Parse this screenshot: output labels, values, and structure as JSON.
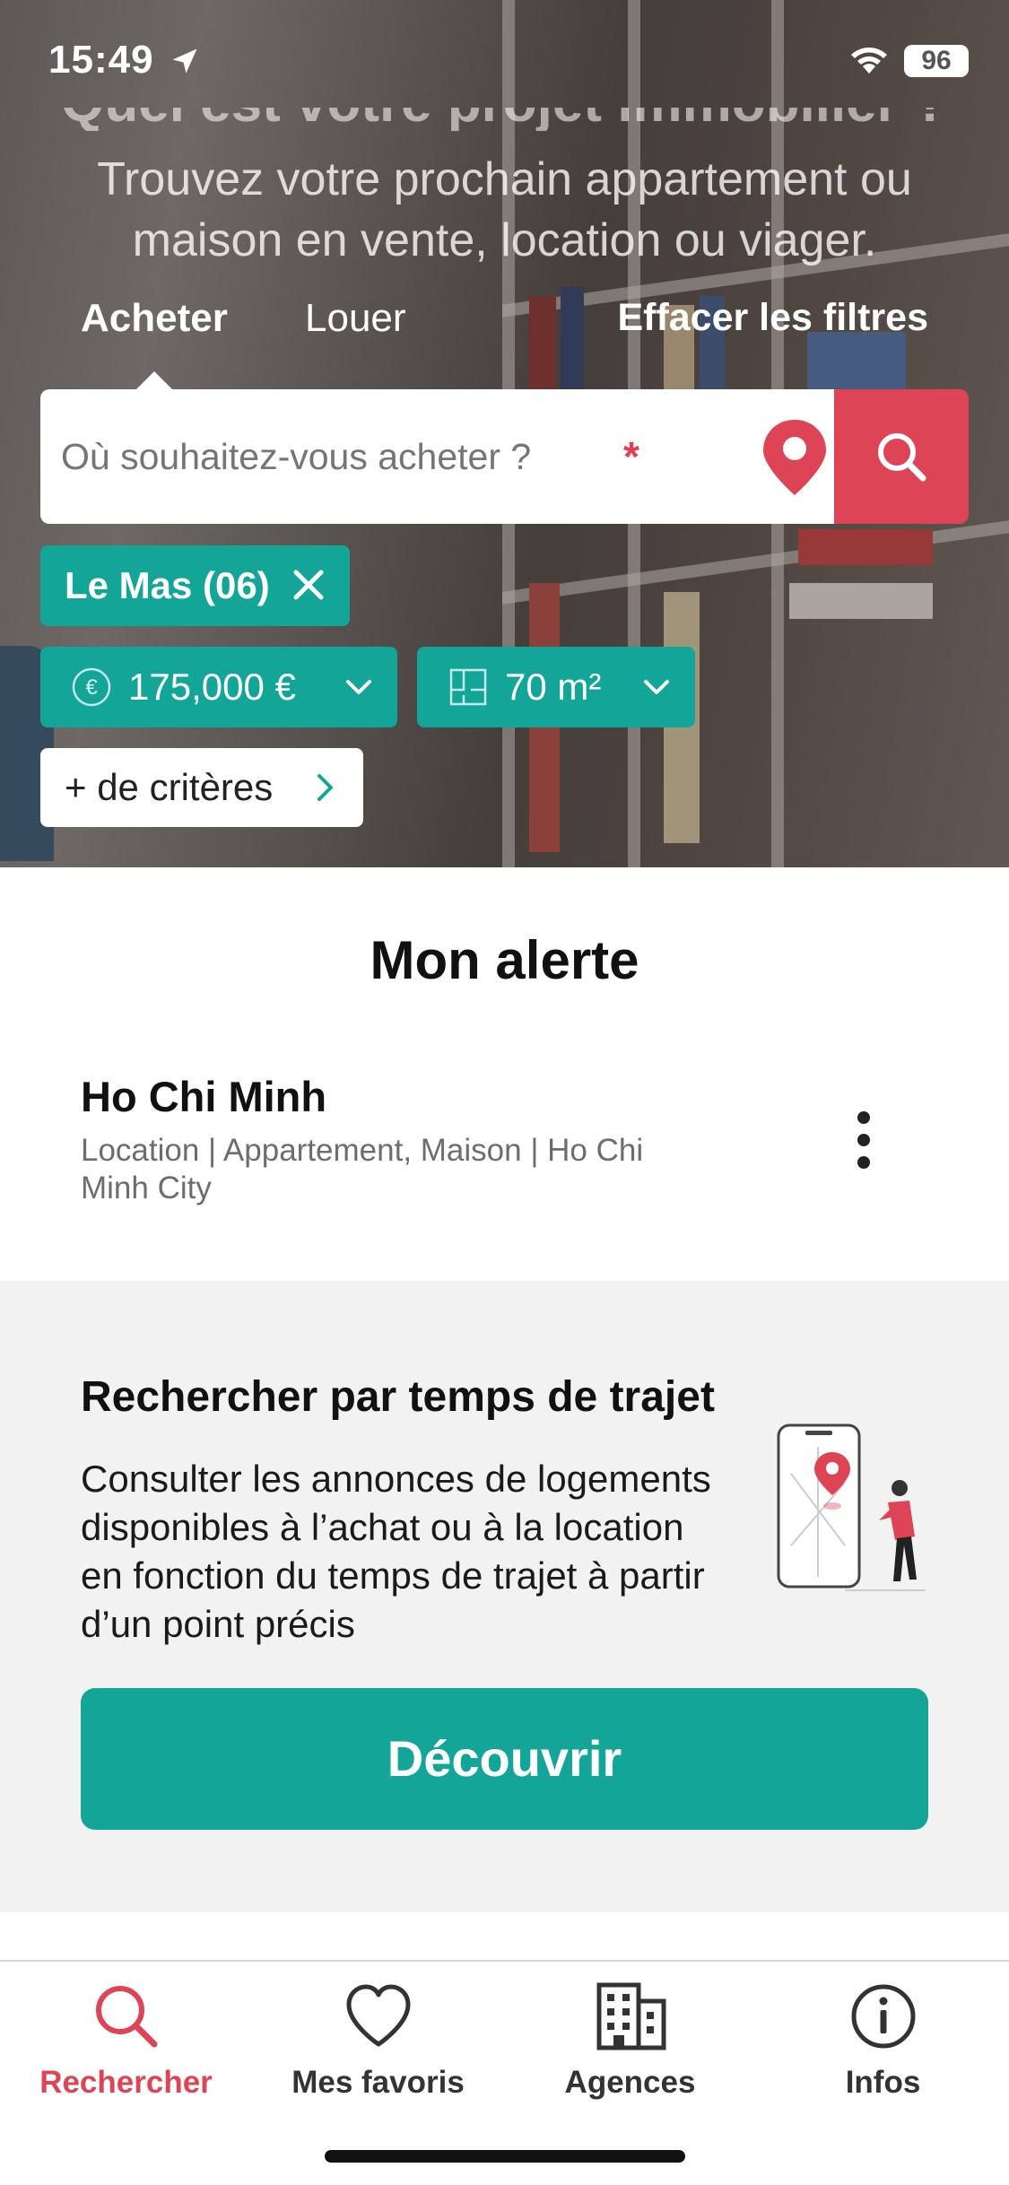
{
  "status_bar": {
    "time": "15:49",
    "battery": "96"
  },
  "hero": {
    "title_partial": "Quel est votre projet immobilier ?",
    "subtitle": "Trouvez votre prochain appartement ou maison en vente, location ou viager.",
    "tabs": [
      {
        "label": "Acheter",
        "active": true
      },
      {
        "label": "Louer",
        "active": false
      }
    ],
    "clear_filters": "Effacer les filtres",
    "search": {
      "placeholder": "Où souhaitez-vous acheter ?",
      "required_mark": "*"
    },
    "filters": {
      "location_chip": "Le Mas (06)",
      "price": "175,000 €",
      "area": "70 m²",
      "more_criteria": "+ de critères"
    }
  },
  "alert": {
    "heading": "Mon alerte",
    "name": "Ho Chi Minh",
    "description": "Location | Appartement, Maison | Ho Chi Minh City"
  },
  "travel": {
    "title": "Rechercher par temps de trajet",
    "description": "Consulter les annonces de logements disponibles à l’achat ou à la location en fonction du temps de trajet à partir d’un point précis",
    "button": "Découvrir"
  },
  "bottom_nav": {
    "items": [
      {
        "label": "Rechercher",
        "icon": "search-icon",
        "active": true
      },
      {
        "label": "Mes favoris",
        "icon": "heart-icon",
        "active": false
      },
      {
        "label": "Agences",
        "icon": "building-icon",
        "active": false
      },
      {
        "label": "Infos",
        "icon": "info-icon",
        "active": false
      }
    ]
  },
  "colors": {
    "accent_red": "#dd4556",
    "accent_teal": "#12a598"
  }
}
